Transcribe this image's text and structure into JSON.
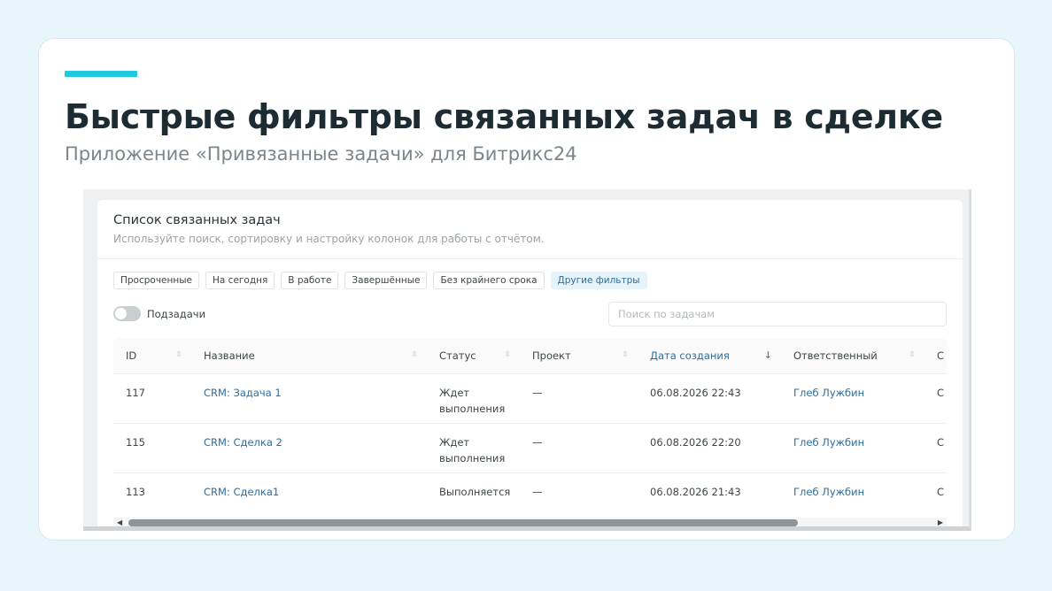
{
  "slide": {
    "title": "Быстрые фильтры связанных задач в сделке",
    "subtitle": "Приложение «Привязанные задачи» для Битрикс24"
  },
  "panel": {
    "title": "Список связанных задач",
    "description": "Используйте поиск, сортировку и настройку колонок для работы с отчётом."
  },
  "filters": [
    {
      "label": "Просроченные",
      "active": false
    },
    {
      "label": "На сегодня",
      "active": false
    },
    {
      "label": "В работе",
      "active": false
    },
    {
      "label": "Завершённые",
      "active": false
    },
    {
      "label": "Без крайнего срока",
      "active": false
    },
    {
      "label": "Другие фильтры",
      "active": true
    }
  ],
  "toggle": {
    "label": "Подзадачи",
    "on": false
  },
  "search": {
    "placeholder": "Поиск по задачам",
    "value": ""
  },
  "table": {
    "columns": [
      {
        "label": "ID",
        "sort": "neutral"
      },
      {
        "label": "Название",
        "sort": "neutral"
      },
      {
        "label": "Статус",
        "sort": "neutral"
      },
      {
        "label": "Проект",
        "sort": "neutral"
      },
      {
        "label": "Дата создания",
        "sort": "desc"
      },
      {
        "label": "Ответственный",
        "sort": "neutral"
      },
      {
        "label": "С",
        "sort": "none"
      }
    ],
    "rows": [
      {
        "id": "117",
        "name": "CRM: Задача 1",
        "status": "Ждет выполнения",
        "project": "—",
        "created": "06.08.2026 22:43",
        "responsible": "Глеб Лужбин",
        "extra": "С"
      },
      {
        "id": "115",
        "name": "CRM: Сделка 2",
        "status": "Ждет выполнения",
        "project": "—",
        "created": "06.08.2026 22:20",
        "responsible": "Глеб Лужбин",
        "extra": "С"
      },
      {
        "id": "113",
        "name": "CRM: Сделка1",
        "status": "Выполняется",
        "project": "—",
        "created": "06.08.2026 21:43",
        "responsible": "Глеб Лужбин",
        "extra": "С"
      }
    ]
  },
  "icons": {
    "sort_neutral": "sort-icon",
    "sort_desc": "arrow-down-icon",
    "scroll_left": "triangle-left-icon",
    "scroll_right": "triangle-right-icon"
  },
  "colors": {
    "accent": "#21c9df",
    "link": "#2c6da0",
    "background": "#e8f6fc"
  }
}
